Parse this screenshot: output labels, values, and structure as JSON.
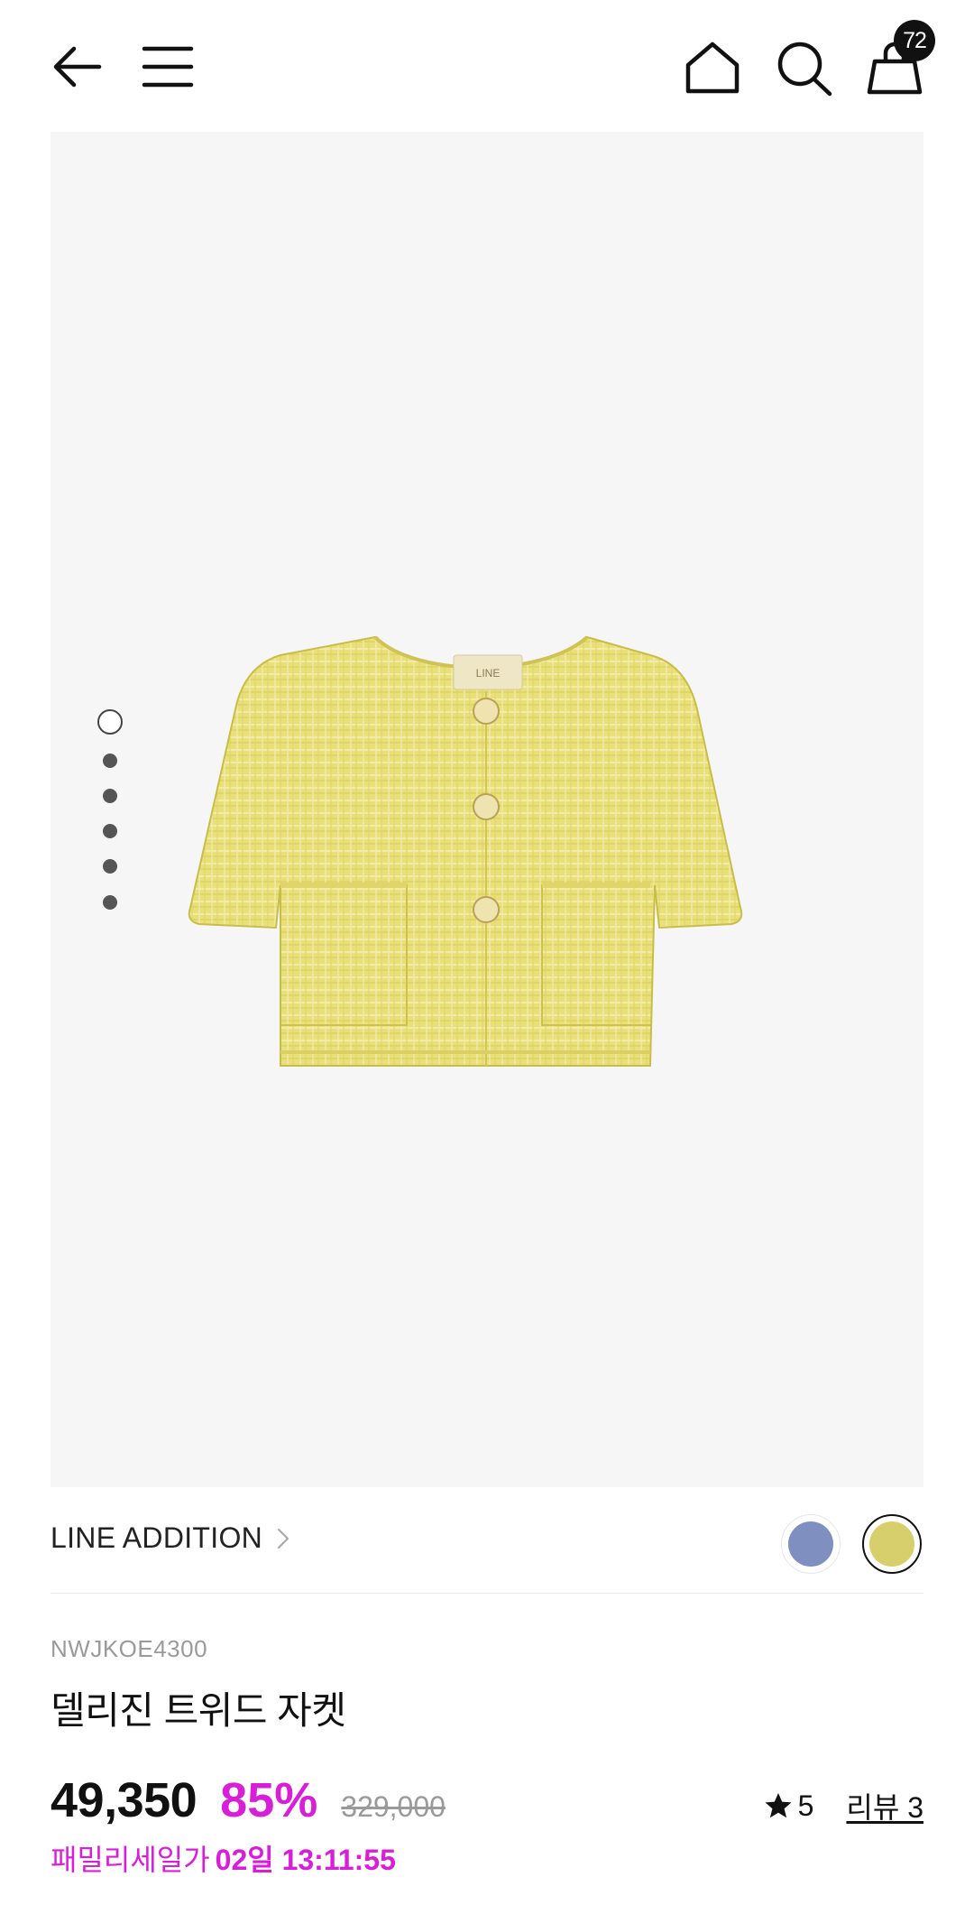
{
  "header": {
    "cart_count": "72"
  },
  "icons": {
    "back": "arrow-left-icon",
    "menu": "hamburger-menu-icon",
    "home": "home-icon",
    "search": "search-icon",
    "cart": "shopping-bag-icon"
  },
  "gallery": {
    "image_count": 6,
    "active_index": 0
  },
  "brand": {
    "name": "LINE ADDITION"
  },
  "swatches": [
    {
      "color": "#7f8fbf",
      "selected": false
    },
    {
      "color": "#d6cf6c",
      "selected": true
    }
  ],
  "product": {
    "code": "NWJKOE4300",
    "name": "델리진 트위드 자켓",
    "price": "49,350",
    "discount": "85%",
    "original_price": "329,000",
    "rating": "5",
    "review_label": "리뷰 3",
    "sale_label": "패밀리세일가",
    "sale_countdown": "02일 13:11:55"
  },
  "colors": {
    "accent": "#d81fd8",
    "image_bg": "#f6f6f6",
    "jacket": "#e9e079"
  }
}
